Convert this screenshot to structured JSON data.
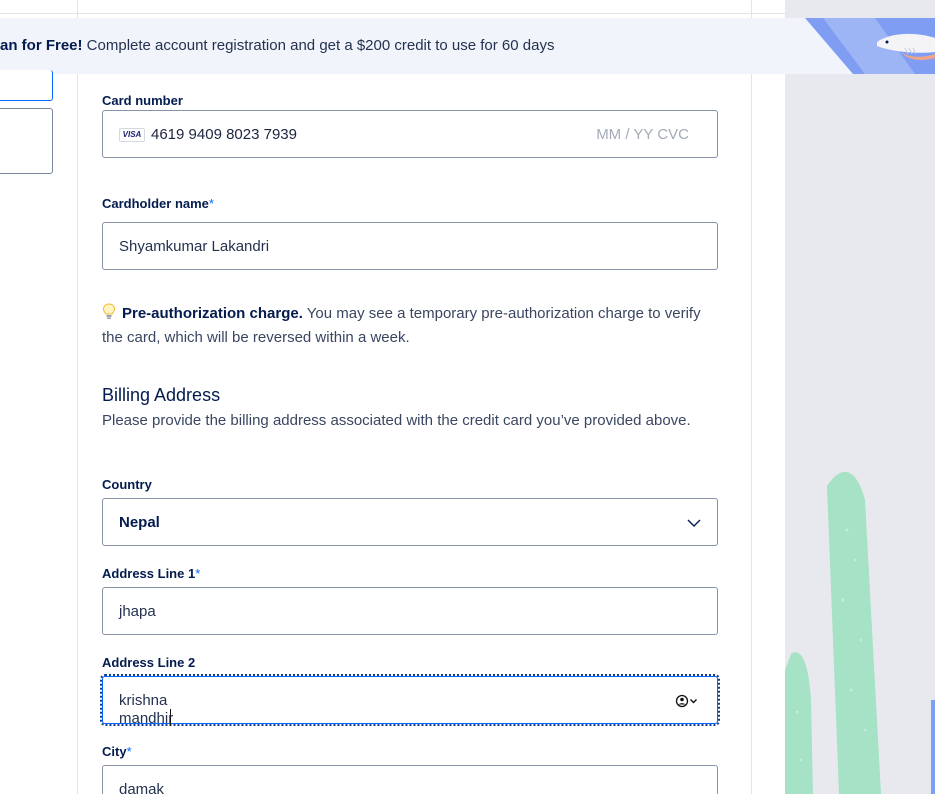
{
  "banner": {
    "bold": "an for Free!",
    "text": " Complete account registration and get a $200 credit to use for 60 days"
  },
  "card": {
    "label": "Card number",
    "brand": "VISA",
    "number": "4619 9409 8023 7939",
    "expiry_cvc_placeholder": "MM / YY  CVC"
  },
  "cardholder": {
    "label": "Cardholder name",
    "required_mark": "*",
    "value": "Shyamkumar Lakandri"
  },
  "preauth": {
    "bold": "Pre-authorization charge.",
    "text": " You may see a temporary pre-authorization charge to verify the card, which will be reversed within a week."
  },
  "billing": {
    "heading": "Billing Address",
    "description": "Please provide the billing address associated with the credit card you’ve provided above."
  },
  "country": {
    "label": "Country",
    "value": "Nepal"
  },
  "address1": {
    "label": "Address Line 1",
    "required_mark": "*",
    "value": "jhapa"
  },
  "address2": {
    "label": "Address Line 2",
    "value": "krishna mandhir"
  },
  "city": {
    "label": "City",
    "required_mark": "*",
    "value": "damak"
  },
  "colors": {
    "accent": "#0069ff",
    "text_dark": "#031b4e",
    "banner_bg": "#f1f4fb",
    "side_panel": "#e8e9ee",
    "plant_green": "#a6e2c6"
  }
}
